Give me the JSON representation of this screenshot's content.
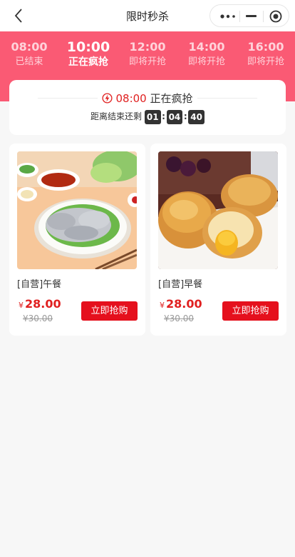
{
  "nav": {
    "title": "限时秒杀",
    "back_icon": "chevron-left-icon",
    "more_icon": "more-dots-icon",
    "minimize_icon": "minimize-icon",
    "close_icon": "target-close-icon"
  },
  "sessions": [
    {
      "time": "08:00",
      "state": "已结束"
    },
    {
      "time": "10:00",
      "state": "正在疯抢",
      "active": true
    },
    {
      "time": "12:00",
      "state": "即将开抢"
    },
    {
      "time": "14:00",
      "state": "即将开抢"
    },
    {
      "time": "16:00",
      "state": "即将开抢"
    }
  ],
  "countdown": {
    "icon": "lightning-circle-icon",
    "time": "08:00",
    "status": "正在疯抢",
    "label": "距离结束还剩",
    "hours": "01",
    "minutes": "04",
    "seconds": "40"
  },
  "products": [
    {
      "name": "[自营]午餐",
      "currency": "¥",
      "price": "28.00",
      "old_price": "¥30.00",
      "button": "立即抢购",
      "image": "dumpling-plate-photo"
    },
    {
      "name": "[自营]早餐",
      "currency": "¥",
      "price": "28.00",
      "old_price": "¥30.00",
      "button": "立即抢购",
      "image": "croissant-photo"
    }
  ],
  "colors": {
    "primary": "#fa5a74",
    "price": "#e02020",
    "button": "#e5101d"
  }
}
